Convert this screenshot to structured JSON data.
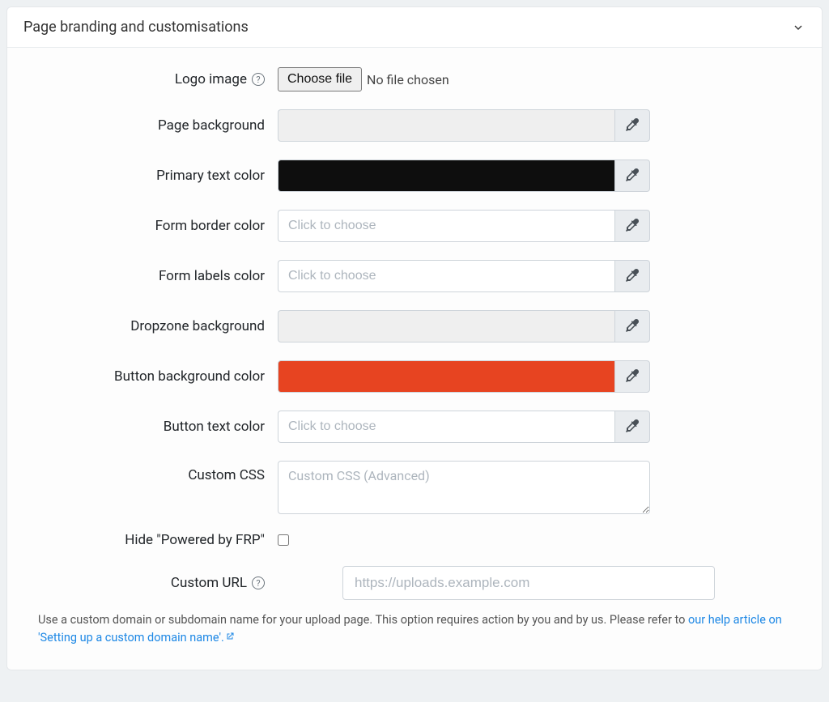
{
  "panel": {
    "title": "Page branding and customisations"
  },
  "fields": {
    "logo": {
      "label": "Logo image",
      "button": "Choose file",
      "status": "No file chosen"
    },
    "page_bg": {
      "label": "Page background",
      "value": "",
      "swatch": "#efefef"
    },
    "primary_text": {
      "label": "Primary text color",
      "value": "",
      "swatch": "#0e0e0e"
    },
    "form_border": {
      "label": "Form border color",
      "placeholder": "Click to choose",
      "value": ""
    },
    "form_labels": {
      "label": "Form labels color",
      "placeholder": "Click to choose",
      "value": ""
    },
    "dropzone_bg": {
      "label": "Dropzone background",
      "value": "",
      "swatch": "#efefef"
    },
    "button_bg": {
      "label": "Button background color",
      "value": "",
      "swatch": "#e74421"
    },
    "button_text": {
      "label": "Button text color",
      "placeholder": "Click to choose",
      "value": ""
    },
    "custom_css": {
      "label": "Custom CSS",
      "placeholder": "Custom CSS (Advanced)"
    },
    "hide_powered": {
      "label": "Hide \"Powered by FRP\"",
      "checked": false
    },
    "custom_url": {
      "label": "Custom URL",
      "placeholder": "https://uploads.example.com"
    }
  },
  "help": {
    "prefix": "Use a custom domain or subdomain name for your upload page. This option requires action by you and by us. Please refer to ",
    "link": "our help article on 'Setting up a custom domain name'."
  }
}
